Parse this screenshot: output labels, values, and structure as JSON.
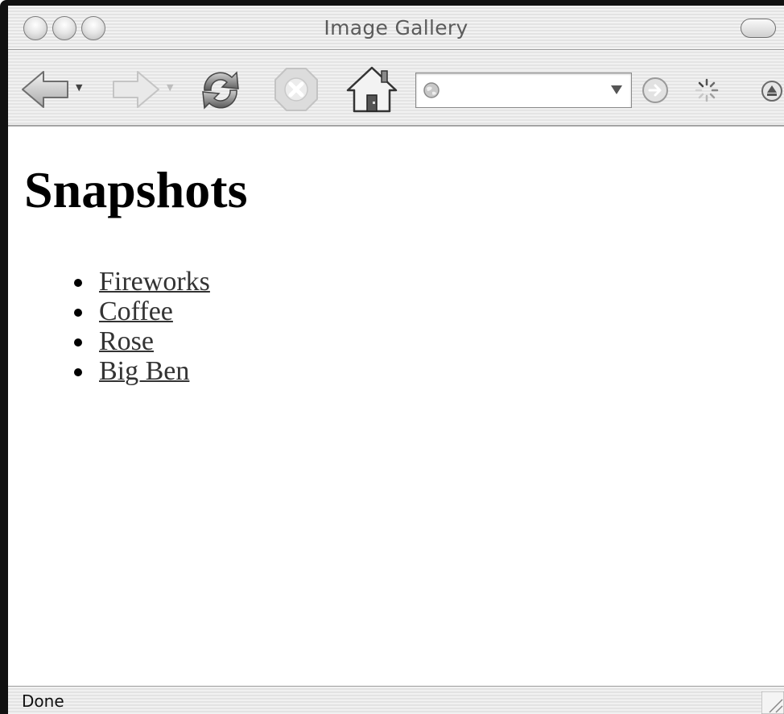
{
  "window": {
    "title": "Image Gallery"
  },
  "toolbar": {
    "back_icon": "back-arrow-icon",
    "forward_icon": "forward-arrow-icon",
    "reload_icon": "reload-icon",
    "stop_icon": "stop-icon",
    "home_icon": "home-icon",
    "address": {
      "value": "",
      "placeholder": ""
    },
    "go_icon": "go-arrow-icon",
    "throbber_icon": "spinner-icon",
    "activity_icon": "circle-up-icon"
  },
  "page": {
    "heading": "Snapshots",
    "links": [
      {
        "label": "Fireworks"
      },
      {
        "label": "Coffee"
      },
      {
        "label": "Rose"
      },
      {
        "label": "Big Ben"
      }
    ]
  },
  "status": {
    "text": "Done"
  },
  "colors": {
    "link": "#333333",
    "chrome": "#e8e8e8"
  }
}
